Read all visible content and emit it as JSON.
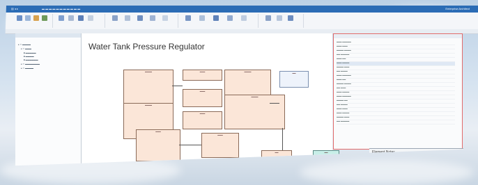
{
  "app": {
    "brand": "Enterprise Architect"
  },
  "diagram": {
    "title": "Water Tank Pressure Regulator"
  },
  "notes": {
    "title": "Element Notes"
  },
  "colors": {
    "ribbon": "#2b6cb5",
    "block_fill": "#fbe6d8",
    "teal_block": "#c8efe8",
    "highlight": "#e26b6b"
  }
}
